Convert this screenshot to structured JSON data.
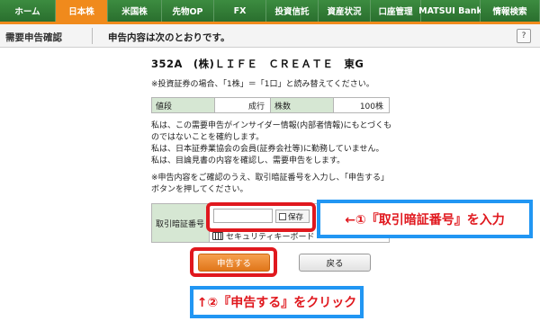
{
  "nav": {
    "tabs": [
      {
        "label": "ホーム"
      },
      {
        "label": "日本株"
      },
      {
        "label": "米国株"
      },
      {
        "label": "先物OP"
      },
      {
        "label": "FX"
      },
      {
        "label": "投資信託"
      },
      {
        "label": "資産状況"
      },
      {
        "label": "口座管理"
      },
      {
        "label": "MATSUI Bank"
      },
      {
        "label": "情報検索"
      }
    ],
    "active_tab": "日本株"
  },
  "subheader": {
    "title": "需要申告確認",
    "message": "申告内容は次のとおりです。",
    "help_label": "?"
  },
  "stock": {
    "title": "352A　(株)ＬＩＦＥ　ＣＲＥＡＴＥ　東G"
  },
  "notes": {
    "unit_note": "※投資証券の場合、「1株」＝「1口」と読み替えてください。",
    "declarations": [
      "私は、この需要申告がインサイダー情報(内部者情報)にもとづくものではないことを確約します。",
      "私は、日本証券業協会の会員(証券会社等)に勤務していません。",
      "私は、目論見書の内容を確認し、需要申告をします。"
    ],
    "confirm_note": "※申告内容をご確認のうえ、取引暗証番号を入力し、「申告する」ボタンを押してください。"
  },
  "order": {
    "price_label": "値段",
    "price_value": "成行",
    "qty_label": "株数",
    "qty_value": "100株"
  },
  "pin": {
    "label": "取引暗証番号",
    "save_label": "保存",
    "keyboard_label": "セキュリティキーボード"
  },
  "buttons": {
    "submit": "申告する",
    "back": "戻る"
  },
  "annotations": {
    "step1": "←①『取引暗証番号』を入力",
    "step2": "↑②『申告する』をクリック"
  },
  "colors": {
    "nav_green": "#2e7d32",
    "accent_orange": "#f08a1c",
    "highlight_red": "#e0181e",
    "callout_blue": "#2196f3"
  }
}
